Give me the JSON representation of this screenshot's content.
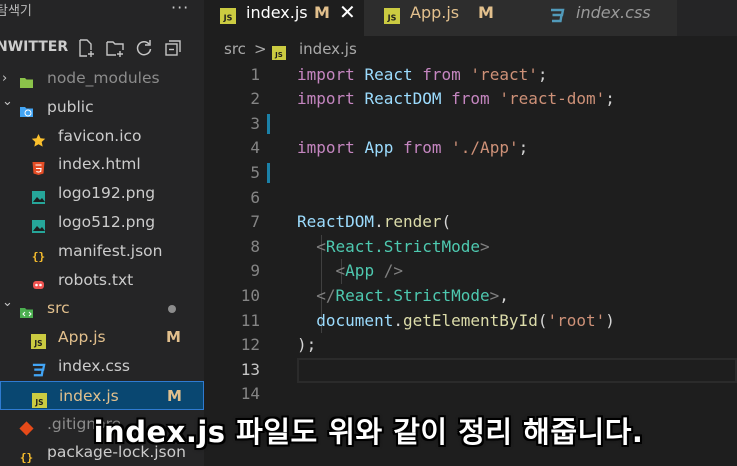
{
  "explorer": {
    "title": "탐색기",
    "more": "···",
    "project": "NWITTER",
    "items": [
      {
        "label": "node_modules",
        "icon": "node-folder-icon",
        "chevron": "›",
        "state": "grey"
      },
      {
        "label": "public",
        "icon": "globe-folder-icon",
        "chevron": "⌄",
        "state": "normal"
      },
      {
        "label": "favicon.ico",
        "icon": "star-icon",
        "state": "normal"
      },
      {
        "label": "index.html",
        "icon": "html5-icon",
        "state": "normal"
      },
      {
        "label": "logo192.png",
        "icon": "image-icon",
        "state": "normal"
      },
      {
        "label": "logo512.png",
        "icon": "image-icon",
        "state": "normal"
      },
      {
        "label": "manifest.json",
        "icon": "json-icon",
        "state": "normal"
      },
      {
        "label": "robots.txt",
        "icon": "robot-icon",
        "state": "normal"
      },
      {
        "label": "src",
        "icon": "src-folder-icon",
        "chevron": "⌄",
        "state": "modified",
        "dot": true
      },
      {
        "label": "App.js",
        "icon": "js-icon",
        "state": "modified",
        "badge": "M"
      },
      {
        "label": "index.css",
        "icon": "css-icon",
        "state": "normal"
      },
      {
        "label": "index.js",
        "icon": "js-icon",
        "state": "modified",
        "badge": "M",
        "selected": true
      },
      {
        "label": ".gitignore",
        "icon": "git-icon",
        "state": "grey"
      },
      {
        "label": "package-lock.json",
        "icon": "json-icon",
        "state": "normal"
      }
    ]
  },
  "tabs": [
    {
      "label": "index.js",
      "badge": "M",
      "close": "✕",
      "active": true,
      "icon": "js-icon"
    },
    {
      "label": "App.js",
      "badge": "M",
      "active": false,
      "icon": "js-icon"
    },
    {
      "label": "index.css",
      "active": false,
      "icon": "css-icon"
    }
  ],
  "breadcrumb": {
    "folder": "src",
    "separator": ">",
    "file": "index.js"
  },
  "editor": {
    "line_numbers": [
      "1",
      "2",
      "3",
      "4",
      "5",
      "6",
      "7",
      "8",
      "9",
      "10",
      "11",
      "12",
      "13",
      "14"
    ],
    "current_line": "13",
    "lines": [
      [
        [
          "kw",
          "import"
        ],
        [
          "pl",
          " "
        ],
        [
          "var",
          "React"
        ],
        [
          "pl",
          " "
        ],
        [
          "kw",
          "from"
        ],
        [
          "pl",
          " "
        ],
        [
          "str",
          "'react'"
        ],
        [
          "pl",
          ";"
        ]
      ],
      [
        [
          "kw",
          "import"
        ],
        [
          "pl",
          " "
        ],
        [
          "var",
          "ReactDOM"
        ],
        [
          "pl",
          " "
        ],
        [
          "kw",
          "from"
        ],
        [
          "pl",
          " "
        ],
        [
          "str",
          "'react-dom'"
        ],
        [
          "pl",
          ";"
        ]
      ],
      [],
      [
        [
          "kw",
          "import"
        ],
        [
          "pl",
          " "
        ],
        [
          "var",
          "App"
        ],
        [
          "pl",
          " "
        ],
        [
          "kw",
          "from"
        ],
        [
          "pl",
          " "
        ],
        [
          "str",
          "'./App'"
        ],
        [
          "pl",
          ";"
        ]
      ],
      [],
      [],
      [
        [
          "var",
          "ReactDOM"
        ],
        [
          "pl",
          "."
        ],
        [
          "fn",
          "render"
        ],
        [
          "pl",
          "("
        ]
      ],
      [
        [
          "pl",
          "  "
        ],
        [
          "tag",
          "<"
        ],
        [
          "jsx",
          "React.StrictMode"
        ],
        [
          "tag",
          ">"
        ]
      ],
      [
        [
          "pl",
          "    "
        ],
        [
          "tag",
          "<"
        ],
        [
          "jsx",
          "App"
        ],
        [
          "pl",
          " "
        ],
        [
          "tag",
          "/>"
        ]
      ],
      [
        [
          "pl",
          "  "
        ],
        [
          "tag",
          "</"
        ],
        [
          "jsx",
          "React.StrictMode"
        ],
        [
          "tag",
          ">"
        ],
        [
          "pl",
          ","
        ]
      ],
      [
        [
          "pl",
          "  "
        ],
        [
          "var",
          "document"
        ],
        [
          "pl",
          "."
        ],
        [
          "fn",
          "getElementById"
        ],
        [
          "pl",
          "("
        ],
        [
          "str",
          "'root'"
        ],
        [
          "pl",
          ")"
        ]
      ],
      [
        [
          "pl",
          ");"
        ]
      ],
      [],
      []
    ]
  },
  "caption": "index.js 파일도 위와 같이 정리  해줍니다."
}
